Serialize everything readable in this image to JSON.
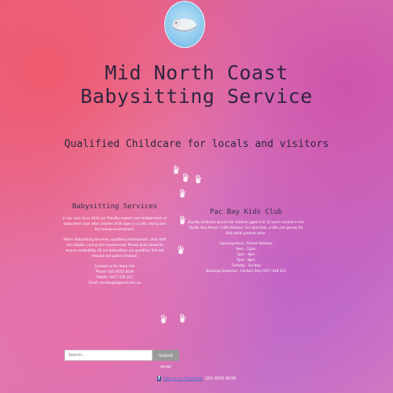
{
  "header": {
    "title_line1": "Mid North Coast",
    "title_line2": "Babysitting Service",
    "tagline": "Qualified Childcare for locals and visitors"
  },
  "left_section": {
    "heading": "Babysitting Services",
    "paragraph1": "In our care since 2010 our friendly mature and reliable team of babysitters look after children of all ages in a safe, caring and fun loving environment.",
    "paragraph2": "Rates: Babysitting Services, qualified professionals, child staff are reliable, caring and experienced. Please book ahead to ensure availability. All our babysitters are qualified, first aid trained and police checked.",
    "contact_heading": "Contact us for more info",
    "phone": "Phone: (02) 6555 8239",
    "mobile": "Mobile: 0417 439 323",
    "email": "Email: mncbs@bigpond.com.au"
  },
  "right_section": {
    "heading": "Pac Bay Kids Club",
    "paragraph": "Quality childcare service for children aged 4 to 12 years located in the Pacific Bay Resort, Coffs Harbour. Fun activities, crafts and games for kids while parents relax.",
    "hours_heading": "Opening Hours: School Holidays",
    "hours": [
      "9am - 12pm",
      "1pm - 4pm",
      "6pm - 8pm",
      "Tuesday - Sunday"
    ],
    "bookings": "Bookings Essential - Contact Tony 0417 439 323"
  },
  "search": {
    "placeholder": "Search...",
    "button_label": "Submit email"
  },
  "footer": {
    "facebook_label": "Like us on Facebook",
    "phone_text": "(02) 6555 8239"
  }
}
